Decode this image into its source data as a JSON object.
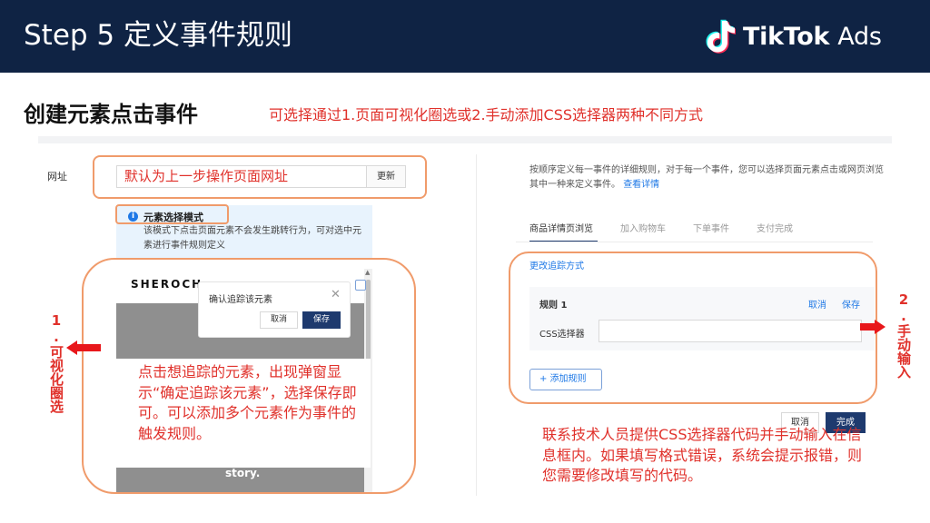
{
  "header": {
    "title": "Step 5 定义事件规则",
    "logo_icon": "tiktok-note-icon",
    "logo_brand": "TikTok",
    "logo_suffix": "Ads"
  },
  "section": {
    "title": "创建元素点击事件",
    "method_note": "可选择通过1.页面可视化圈选或2.手动添加CSS选择器两种不同方式"
  },
  "left_panel": {
    "url_label": "网址",
    "url_value": "默认为上一步操作页面网址",
    "update_button": "更新",
    "mode_title": "元素选择模式",
    "mode_desc": "该模式下点击页面元素不会发生跳转行为，可对选中元素进行事件规则定义",
    "preview_brand": "SHEROCH",
    "preview_story": "story.",
    "dialog_title": "确认追踪该元素",
    "dialog_cancel": "取消",
    "dialog_save": "保存",
    "annotation": "点击想追踪的元素，出现弹窗显示“确定追踪该元素”，选择保存即可。可以添加多个元素作为事件的触发规则。",
    "vertical_label": "1.可视化圈选"
  },
  "right_panel": {
    "desc": "按顺序定义每一事件的详细规则，对于每一个事件，您可以选择页面元素点击或网页浏览其中一种来定义事件。",
    "desc_link": "查看详情",
    "tabs": [
      "商品详情页浏览",
      "加入购物车",
      "下单事件",
      "支付完成"
    ],
    "change_method": "更改追踪方式",
    "rule_title": "规则 1",
    "rule_cancel": "取消",
    "rule_save": "保存",
    "css_label": "CSS选择器",
    "css_placeholder": "",
    "add_rule": "+ 添加规则",
    "cancel_button": "取消",
    "done_button": "完成",
    "vertical_label": "2.手动输入",
    "bottom_note": "联系技术人员提供CSS选择器代码并手动输入在信息框内。如果填写格式错误，系统会提示报错，则您需要修改填写的代码。"
  },
  "colors": {
    "header_bg": "#0f2344",
    "accent_red": "#e0312b",
    "callout_orange": "#f09b6b",
    "primary_blue": "#1e3a6e",
    "link_blue": "#1e78e6"
  }
}
